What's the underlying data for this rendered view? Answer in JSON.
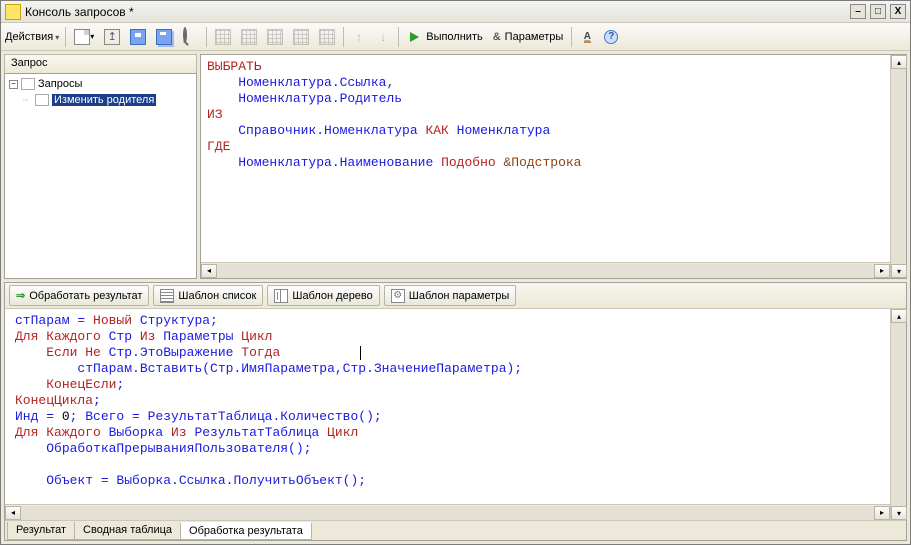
{
  "title": "Консоль запросов *",
  "toolbar": {
    "actions_label": "Действия"
  },
  "execute": {
    "label": "Выполнить",
    "params": "Параметры"
  },
  "tree": {
    "header": "Запрос",
    "root": "Запросы",
    "item1": "Изменить родителя"
  },
  "query": {
    "l1": "ВЫБРАТЬ",
    "l2": "Номенклатура.Ссылка,",
    "l3": "Номенклатура.Родитель",
    "l4": "ИЗ",
    "l5a": "Справочник.Номенклатура ",
    "l5b": "КАК",
    "l5c": " Номенклатура",
    "l6": "ГДЕ",
    "l7a": "Номенклатура.Наименование ",
    "l7b": "Подобно",
    "l7c": " &Подстрока"
  },
  "lowerbar": {
    "process": "Обработать результат",
    "tpl_list": "Шаблон список",
    "tpl_tree": "Шаблон дерево",
    "tpl_params": "Шаблон параметры"
  },
  "code": {
    "l1a": "стПарам = ",
    "l1b": "Новый",
    "l1c": " Структура;",
    "l2a": "Для",
    "l2b": " Каждого",
    "l2c": " Стр ",
    "l2d": "Из",
    "l2e": " Параметры ",
    "l2f": "Цикл",
    "l3a": "Если",
    "l3b": " Не",
    "l3c": " Стр.ЭтоВыражение ",
    "l3d": "Тогда",
    "l4": "стПарам.Вставить(Стр.ИмяПараметра,Стр.ЗначениеПараметра);",
    "l5": "КонецЕсли",
    "l6": "КонецЦикла",
    "l7a": "Инд = ",
    "l7b": "0",
    "l7c": "; Всего = РезультатТаблица.Количество();",
    "l8a": "Для",
    "l8b": " Каждого",
    "l8c": " Выборка ",
    "l8d": "Из",
    "l8e": " РезультатТаблица ",
    "l8f": "Цикл",
    "l9": "ОбработкаПрерыванияПользователя();",
    "l10": "Объект = Выборка.Ссылка.ПолучитьОбъект();"
  },
  "tabs": {
    "t1": "Результат",
    "t2": "Сводная таблица",
    "t3": "Обработка результата"
  }
}
